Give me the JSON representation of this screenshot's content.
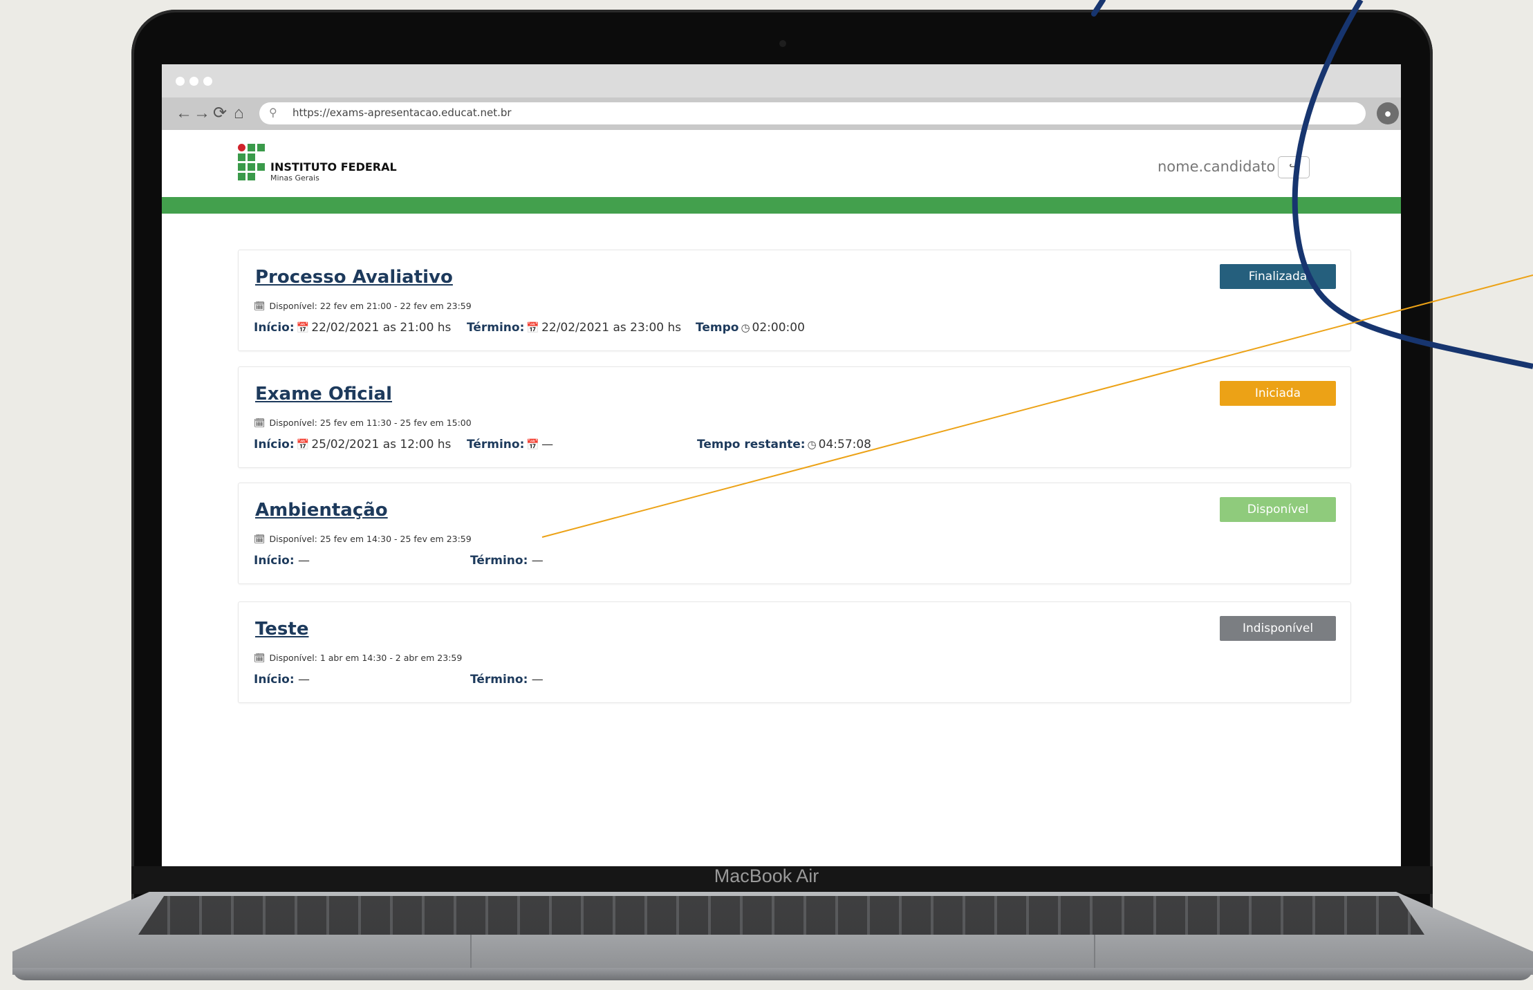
{
  "device": {
    "label": "MacBook Air"
  },
  "browser": {
    "url": "https://exams-apresentacao.educat.net.br",
    "nav_icons": [
      "arrow-left-icon",
      "arrow-right-icon",
      "reload-icon",
      "home-icon"
    ]
  },
  "header": {
    "brand_title": "INSTITUTO FEDERAL",
    "brand_subtitle": "Minas Gerais",
    "username": "nome.candidato",
    "accent_color": "#43a04d"
  },
  "exams": [
    {
      "title": "Processo Avaliativo",
      "availability": "Disponível: 22 fev em 21:00 - 22 fev em 23:59",
      "start_label": "Início:",
      "start_value": "22/02/2021 as 21:00 hs",
      "end_label": "Término:",
      "end_value": "22/02/2021 as 23:00 hs",
      "time_label": "Tempo",
      "time_value": "02:00:00",
      "status": "Finalizada",
      "status_color": "#255f7d"
    },
    {
      "title": "Exame Oficial",
      "availability": "Disponível: 25 fev em 11:30 - 25 fev em 15:00",
      "start_label": "Início:",
      "start_value": "25/02/2021 as 12:00 hs",
      "end_label": "Término:",
      "end_value": "—",
      "time_label": "Tempo restante:",
      "time_value": "04:57:08",
      "status": "Iniciada",
      "status_color": "#eca216"
    },
    {
      "title": "Ambientação",
      "availability": "Disponível: 25 fev em 14:30 - 25 fev em 23:59",
      "start_label": "Início:",
      "start_value": "—",
      "end_label": "Término:",
      "end_value": "—",
      "status": "Disponível",
      "status_color": "#8fcb7c"
    },
    {
      "title": "Teste",
      "availability": "Disponível: 1 abr em 14:30 - 2 abr em 23:59",
      "start_label": "Início:",
      "start_value": "—",
      "end_label": "Término:",
      "end_value": "—",
      "status": "Indisponível",
      "status_color": "#7b7e82"
    }
  ]
}
